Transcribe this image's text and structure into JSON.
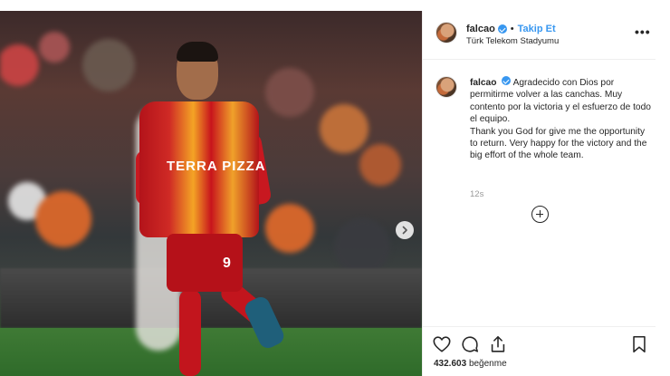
{
  "post": {
    "username": "falcao",
    "verified": true,
    "separator": "•",
    "follow_label": "Takip Et",
    "location": "Türk Telekom Stadyumu",
    "more_label": "•••",
    "caption_username": "falcao",
    "caption_text": "Agradecido con Dios por permitirme volver a las canchas. Muy contento por la victoria y el esfuerzo de todo el equipo.\nThank you God for give me the opportunity to return. Very happy for the victory and the big effort of the whole team.",
    "time_ago": "12s",
    "likes_count": "432.603",
    "likes_label": "beğenme",
    "jersey_sponsor": "TERRA PIZZA",
    "jersey_number": "9"
  },
  "icons": {
    "verified": "verified-badge-icon",
    "more": "more-options-icon",
    "next": "chevron-right-icon",
    "load_more": "plus-circle-icon",
    "like": "heart-icon",
    "comment": "comment-icon",
    "share": "share-icon",
    "save": "bookmark-icon"
  },
  "colors": {
    "accent": "#3897f0",
    "text": "#262626",
    "muted": "#999999",
    "border": "#efefef"
  }
}
